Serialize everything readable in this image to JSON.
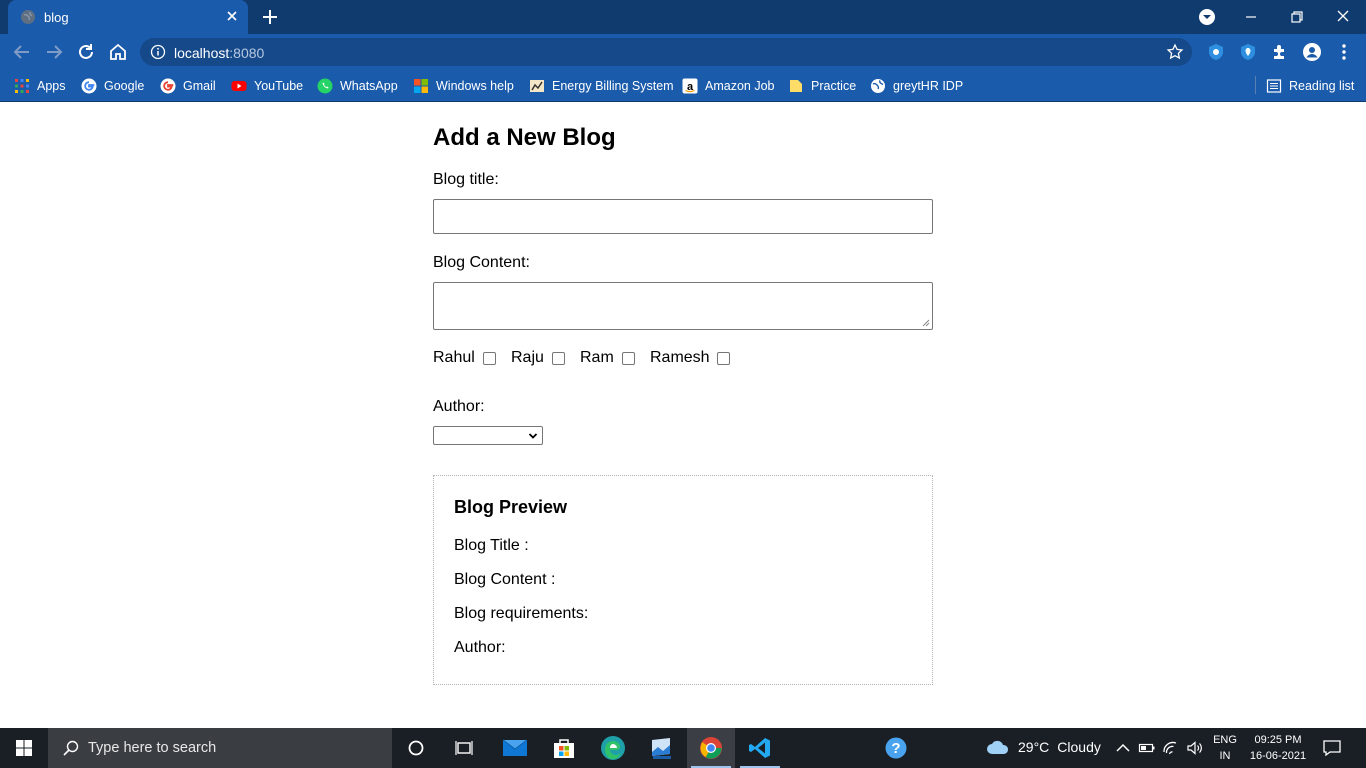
{
  "browser": {
    "tab_title": "blog",
    "url_host": "localhost",
    "url_port": ":8080",
    "reading_list": "Reading list",
    "bookmarks": [
      "Apps",
      "Google",
      "Gmail",
      "YouTube",
      "WhatsApp",
      "Windows help",
      "Energy Billing System",
      "Amazon Job",
      "Practice",
      "greytHR IDP"
    ]
  },
  "form": {
    "heading": "Add a New Blog",
    "title_label": "Blog title:",
    "title_value": "",
    "content_label": "Blog Content:",
    "content_value": "",
    "categories": [
      "Rahul",
      "Raju",
      "Ram",
      "Ramesh"
    ],
    "author_label": "Author:",
    "author_selected": ""
  },
  "preview": {
    "heading": "Blog Preview",
    "title_line": "Blog Title :",
    "content_line": "Blog Content :",
    "requirements_line": "Blog requirements:",
    "author_line": "Author:"
  },
  "taskbar": {
    "search_placeholder": "Type here to search",
    "temperature": "29°C",
    "weather": "Cloudy",
    "lang_line1": "ENG",
    "lang_line2": "IN",
    "time": "09:25 PM",
    "date": "16-06-2021"
  },
  "colors": {
    "titlebar": "#0f3b6e",
    "toolbar": "#1b5bab",
    "taskbar": "#1a1f26"
  }
}
